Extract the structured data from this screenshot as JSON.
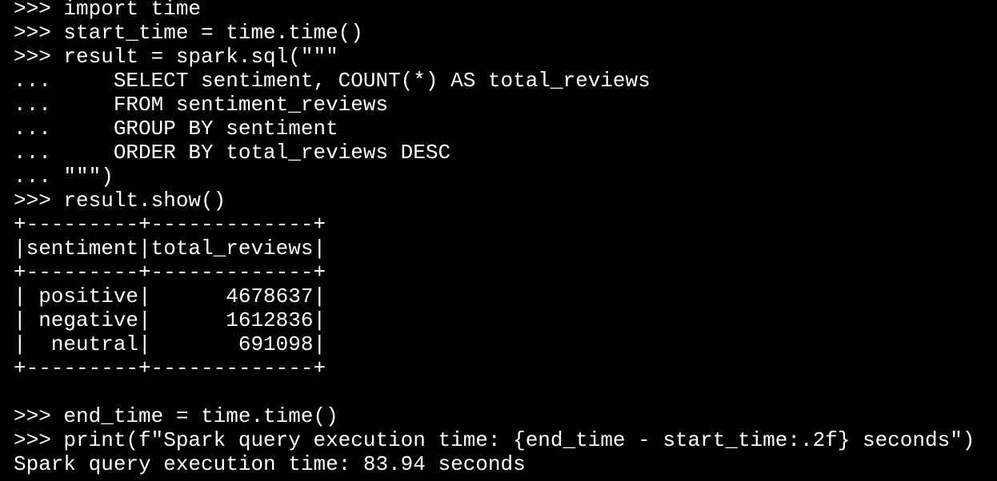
{
  "colors": {
    "background": "#000000",
    "foreground": "#ffffff"
  },
  "terminal": {
    "lines": [
      ">>> import time",
      ">>> start_time = time.time()",
      ">>> result = spark.sql(\"\"\"",
      "...     SELECT sentiment, COUNT(*) AS total_reviews",
      "...     FROM sentiment_reviews",
      "...     GROUP BY sentiment",
      "...     ORDER BY total_reviews DESC",
      "... \"\"\")",
      ">>> result.show()",
      "+---------+-------------+",
      "|sentiment|total_reviews|",
      "+---------+-------------+",
      "| positive|      4678637|",
      "| negative|      1612836|",
      "|  neutral|       691098|",
      "+---------+-------------+",
      "",
      ">>> end_time = time.time()",
      ">>> print(f\"Spark query execution time: {end_time - start_time:.2f} seconds\")",
      "Spark query execution time: 83.94 seconds"
    ],
    "prompt_after": ">>> "
  }
}
